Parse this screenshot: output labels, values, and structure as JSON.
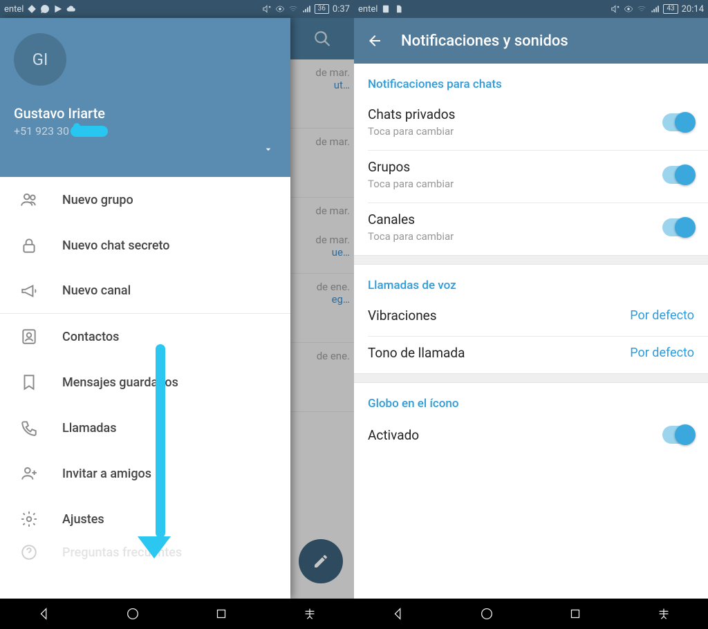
{
  "left": {
    "status": {
      "carrier": "entel",
      "battery": "36",
      "time": "0:37"
    },
    "profile": {
      "initials": "GI",
      "name": "Gustavo Iriarte",
      "phone": "+51 923 30"
    },
    "menu": {
      "new_group": "Nuevo grupo",
      "secret_chat": "Nuevo chat secreto",
      "new_channel": "Nuevo canal",
      "contacts": "Contactos",
      "saved": "Mensajes guardados",
      "calls": "Llamadas",
      "invite": "Invitar a amigos",
      "settings": "Ajustes",
      "faq": "Preguntas frecuentes"
    },
    "chat_peek": {
      "r1_date": "de mar.",
      "r1_blue": "ut…",
      "r2_date": "de mar.",
      "r3_date": "de mar.",
      "r3_blue": "ue…",
      "r4_date": "de ene.",
      "r4_blue": "eg…",
      "r5_date": "de ene."
    }
  },
  "right": {
    "status": {
      "carrier": "entel",
      "battery": "43",
      "time": "20:14"
    },
    "title": "Notificaciones y sonidos",
    "sections": {
      "chats": "Notificaciones para chats",
      "calls": "Llamadas de voz",
      "badge": "Globo en el ícono"
    },
    "rows": {
      "private": {
        "title": "Chats privados",
        "sub": "Toca para cambiar"
      },
      "groups": {
        "title": "Grupos",
        "sub": "Toca para cambiar"
      },
      "channels": {
        "title": "Canales",
        "sub": "Toca para cambiar"
      },
      "vibr": {
        "title": "Vibraciones",
        "value": "Por defecto"
      },
      "ring": {
        "title": "Tono de llamada",
        "value": "Por defecto"
      },
      "badge_on": {
        "title": "Activado"
      }
    }
  }
}
